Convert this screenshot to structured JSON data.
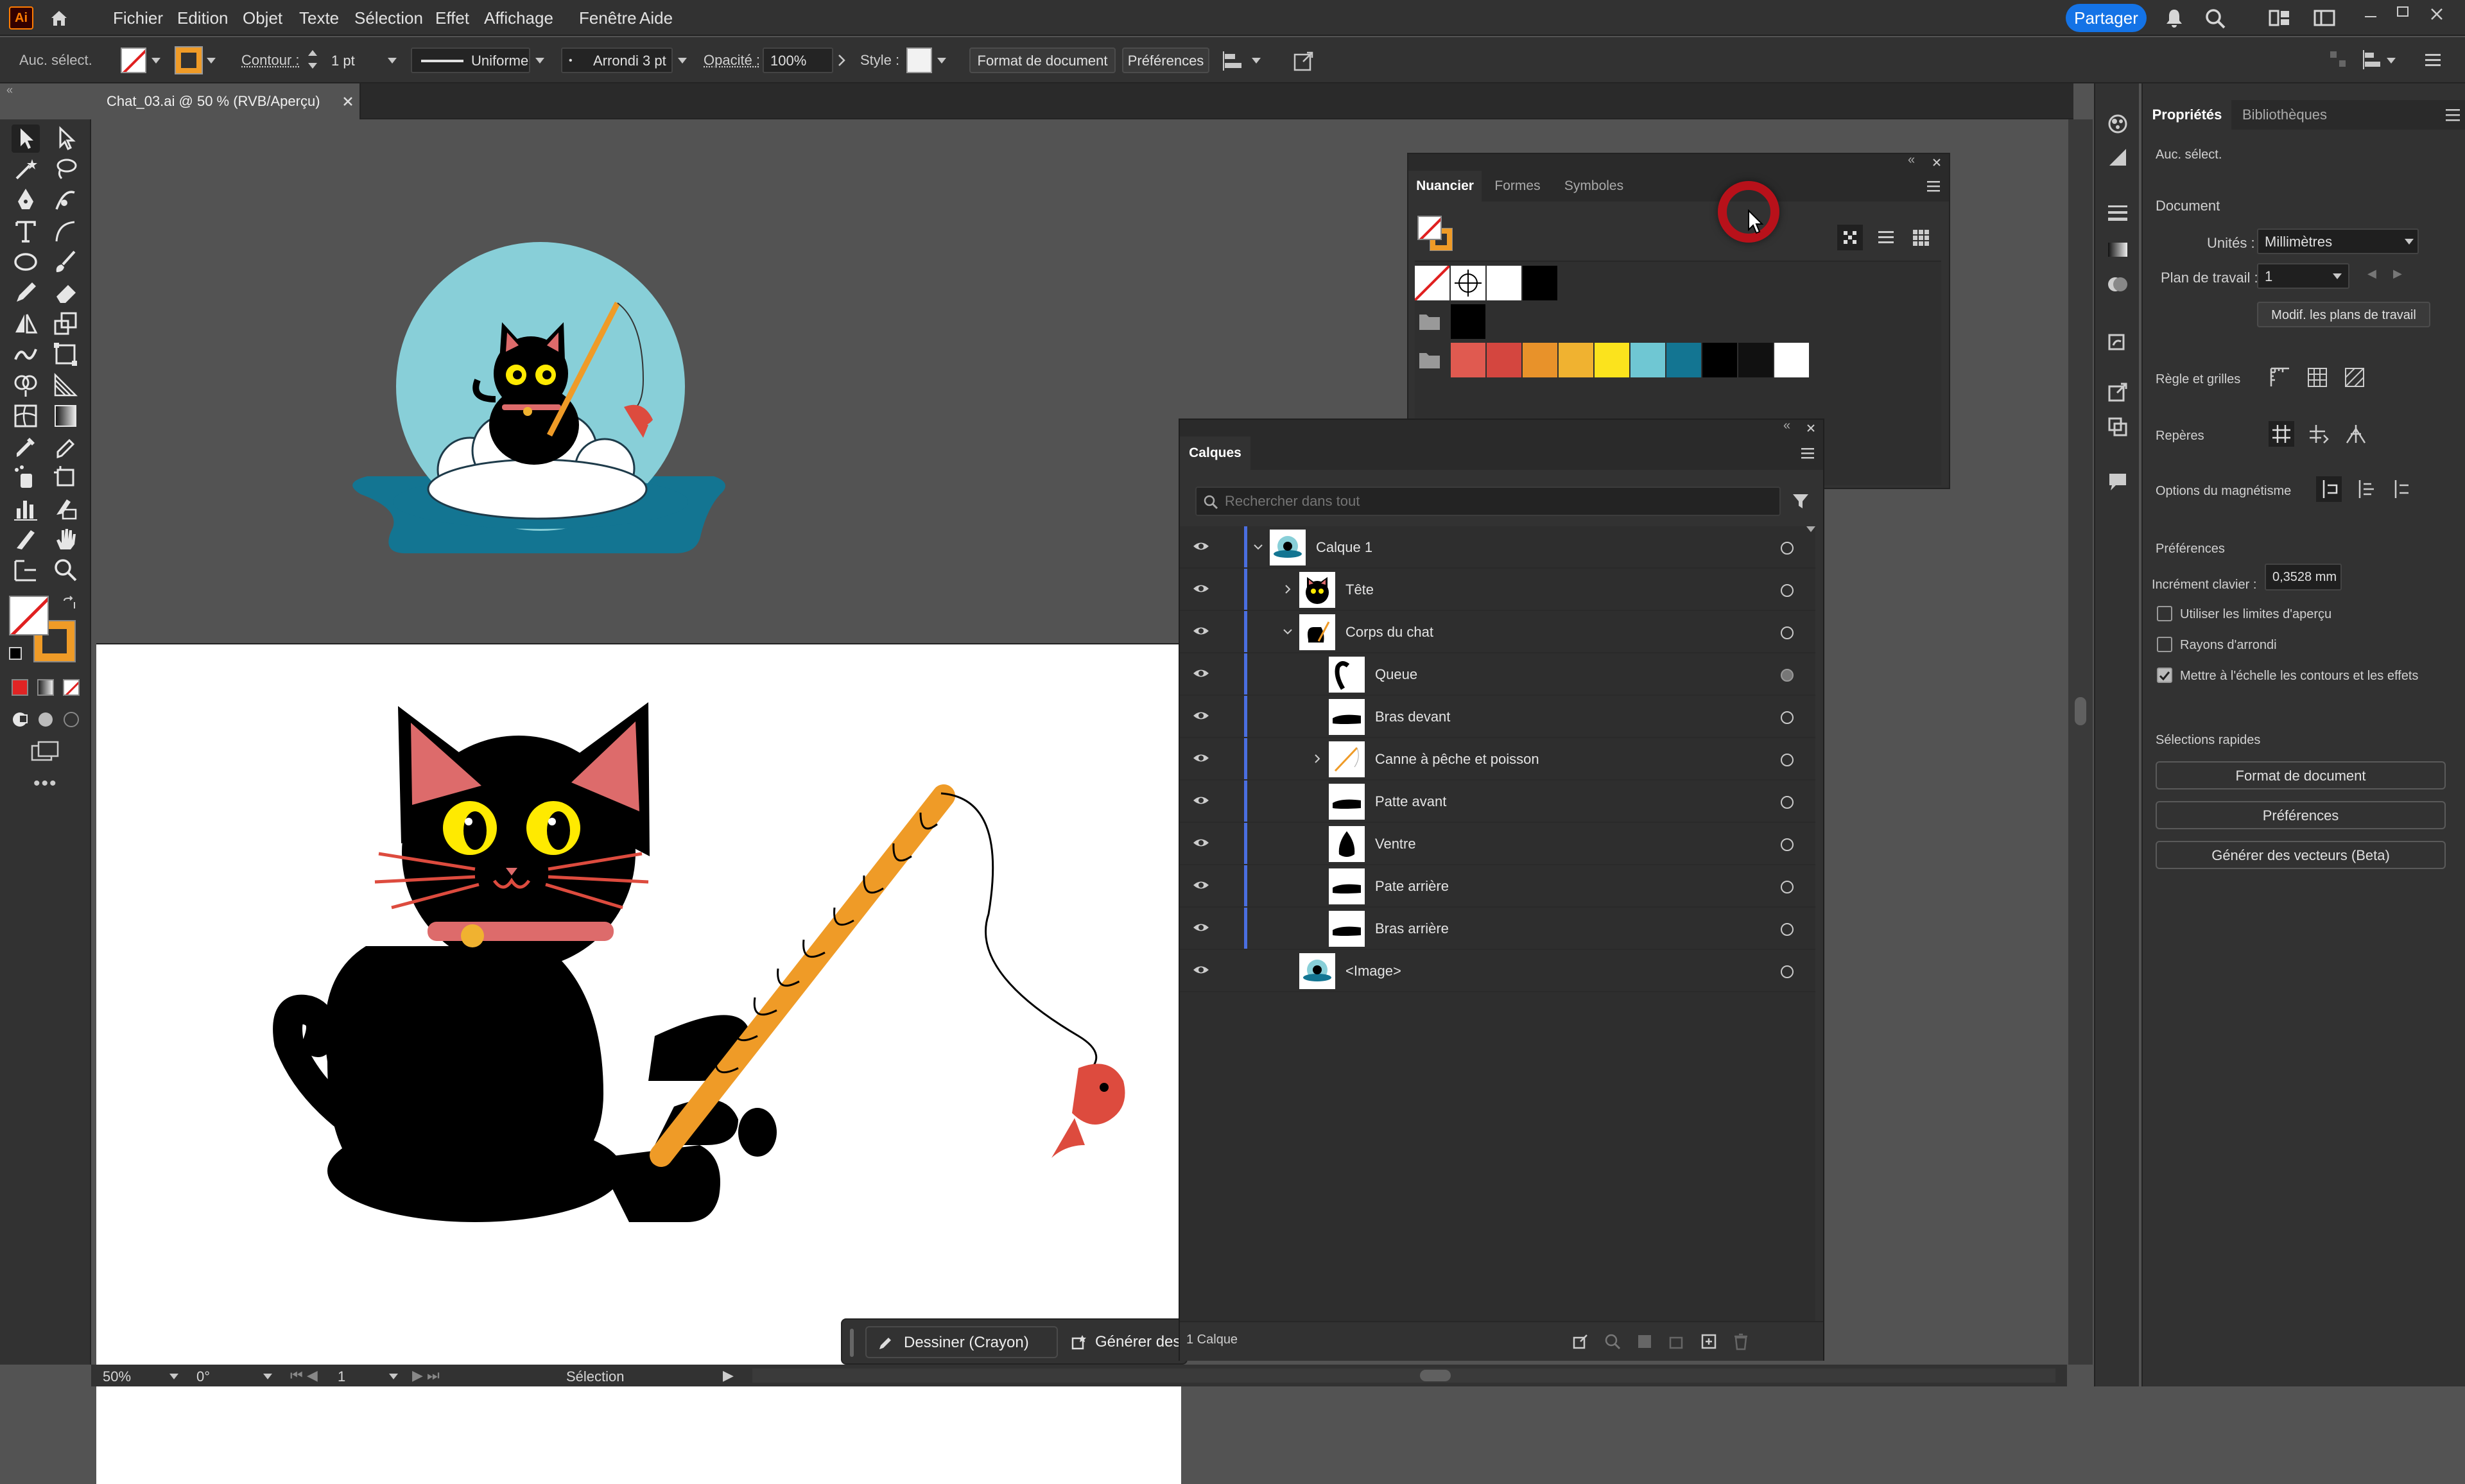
{
  "menubar": {
    "app_badge": "Ai",
    "items": [
      "Fichier",
      "Edition",
      "Objet",
      "Texte",
      "Sélection",
      "Effet",
      "Affichage",
      "Fenêtre",
      "Aide"
    ],
    "share_label": "Partager"
  },
  "control_bar": {
    "selection_status": "Auc. sélect.",
    "stroke_label": "Contour :",
    "stroke_weight": "1 pt",
    "stroke_profile": "Uniforme",
    "brush": "Arrondi 3 pt",
    "opacity_label": "Opacité :",
    "opacity_value": "100%",
    "style_label": "Style :",
    "document_setup_label": "Format de document",
    "preferences_label": "Préférences"
  },
  "document": {
    "tab_title": "Chat_03.ai @ 50 % (RVB/Aperçu)"
  },
  "swatches_panel": {
    "tabs": [
      "Nuancier",
      "Formes",
      "Symboles"
    ],
    "active_tab": "Nuancier",
    "group1": [
      "#ffffff",
      "#000000"
    ],
    "group2": [
      "#000000"
    ],
    "group3": [
      "#e05a50",
      "#d4463f",
      "#e8922a",
      "#f0b230",
      "#fbe31d",
      "#6fc7d3",
      "#137592",
      "#000000",
      "#111111",
      "#ffffff"
    ]
  },
  "layers_panel": {
    "title": "Calques",
    "search_placeholder": "Rechercher dans tout",
    "layers": [
      {
        "name": "Calque 1"
      },
      {
        "name": "Tête"
      },
      {
        "name": "Corps du chat"
      },
      {
        "name": "Queue"
      },
      {
        "name": "Bras devant"
      },
      {
        "name": "Canne à pêche et poisson"
      },
      {
        "name": "Patte avant"
      },
      {
        "name": "Ventre"
      },
      {
        "name": "Pate arrière"
      },
      {
        "name": "Bras arrière"
      },
      {
        "name": "<Image>"
      }
    ],
    "footer_count": "1 Calque"
  },
  "properties_panel": {
    "tabs": [
      "Propriétés",
      "Bibliothèques"
    ],
    "selection_status": "Auc. sélect.",
    "document_section": "Document",
    "units_label": "Unités :",
    "units_value": "Millimètres",
    "artboard_label": "Plan de travail :",
    "artboard_value": "1",
    "edit_artboards_label": "Modif. les plans de travail",
    "rulers_label": "Règle et grilles",
    "guides_label": "Repères",
    "snap_label": "Options du magnétisme",
    "preferences_section": "Préférences",
    "keyboard_increment_label": "Incrément clavier :",
    "keyboard_increment_value": "0,3528 mm",
    "checkboxes": [
      {
        "label": "Utiliser les limites d'aperçu",
        "checked": false
      },
      {
        "label": "Rayons d'arrondi",
        "checked": false
      },
      {
        "label": "Mettre à l'échelle les contours et les effets",
        "checked": true
      }
    ],
    "quick_actions_section": "Sélections rapides",
    "quick_actions": [
      "Format de document",
      "Préférences",
      "Générer des vecteurs (Beta)"
    ]
  },
  "contextual_bar": {
    "draw_label": "Dessiner (Crayon)",
    "generate_label": "Générer des"
  },
  "status_bar": {
    "zoom": "50%",
    "rotation": "0°",
    "artboard": "1",
    "tool": "Sélection"
  }
}
